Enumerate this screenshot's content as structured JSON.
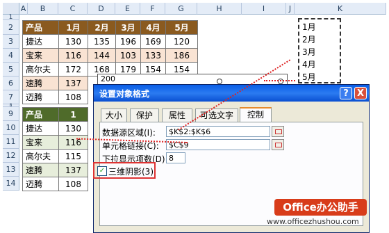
{
  "sheet": {
    "columns": [
      "A",
      "B",
      "C",
      "D",
      "E",
      "F",
      "G",
      "H",
      "I",
      "J",
      "K"
    ],
    "rows": [
      "1",
      "2",
      "3",
      "4",
      "5",
      "6",
      "7",
      "8",
      "9",
      "10",
      "11",
      "12",
      "13",
      "14"
    ]
  },
  "table1": {
    "header": [
      "产品",
      "1月",
      "2月",
      "3月",
      "4月",
      "5月"
    ],
    "rows": [
      [
        "捷达",
        "130",
        "135",
        "196",
        "169",
        "120"
      ],
      [
        "宝来",
        "116",
        "144",
        "103",
        "133",
        "186"
      ],
      [
        "高尔夫",
        "172",
        "168",
        "179",
        "154",
        "154"
      ],
      [
        "速腾",
        "137",
        "",
        "",
        "",
        ""
      ],
      [
        "迈腾",
        "108",
        "",
        "",
        "",
        ""
      ]
    ]
  },
  "table2": {
    "header": [
      "产品",
      "1"
    ],
    "rows": [
      [
        "捷达",
        "130"
      ],
      [
        "宝来",
        "116"
      ],
      [
        "高尔夫",
        "115"
      ],
      [
        "速腾",
        "137"
      ],
      [
        "迈腾",
        "108"
      ]
    ]
  },
  "listbox": {
    "items": [
      "1月",
      "2月",
      "3月",
      "4月",
      "5月"
    ]
  },
  "control_value": "200",
  "dialog": {
    "title": "设置对象格式",
    "help": "?",
    "close": "X",
    "tabs": [
      "大小",
      "保护",
      "属性",
      "可选文字",
      "控制"
    ],
    "active_tab": "控制",
    "input_range_label": "数据源区域(I):",
    "input_range_value": "$K$2:$K$6",
    "cell_link_label": "单元格链接(C):",
    "cell_link_value": "$C$9",
    "dropdown_lines_label": "下拉显示项数(D):",
    "dropdown_lines_value": "8",
    "shading_label": "三维阴影(3)",
    "shading_checked": "✓"
  },
  "watermark": {
    "badge": "Office办公助手",
    "url": "www.officezhushou.com"
  }
}
